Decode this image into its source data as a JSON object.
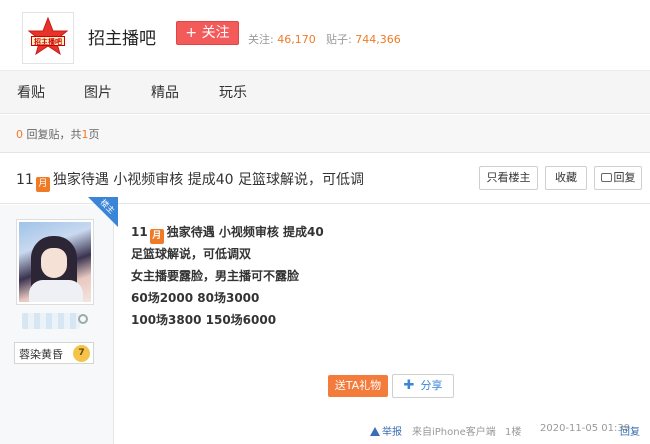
{
  "forum": {
    "logo_text": "招主播吧",
    "name": "招主播吧",
    "follow_label": "+ 关注",
    "follow_count_label": "关注:",
    "follow_count": "46,170",
    "post_count_label": "贴子:",
    "post_count": "744,366"
  },
  "nav": {
    "items": [
      "看贴",
      "图片",
      "精品",
      "玩乐"
    ]
  },
  "pageinfo": {
    "reply_count": "0",
    "reply_label": "回复贴，共",
    "page_count": "1",
    "page_label": "页"
  },
  "thread": {
    "month_num": "11",
    "month_icon": "月",
    "title": "独家待遇 小视频审核 提成40 足篮球解说，可低调",
    "only_author_label": "只看楼主",
    "favorite_label": "收藏",
    "reply_label": "回复"
  },
  "post": {
    "owner_badge": "楼主",
    "level_name": "蓉染黄昏",
    "level_num": "7",
    "content_first_line": "独家待遇 小视频审核 提成40",
    "content_lines": [
      "足篮球解说，可低调双",
      "女主播要露脸，男主播可不露脸",
      "60场2000 80场3000",
      "100场3800 150场6000"
    ],
    "gift_label": "送TA礼物",
    "share_label": "分享",
    "report_label": "举报",
    "source": "来自iPhone客户端",
    "floor": "1楼",
    "time": "2020-11-05 01:39",
    "reply_label": "回复"
  },
  "colors": {
    "accent_orange": "#f07b27",
    "follow_red": "#f35b5b",
    "link_blue": "#3b6fb5"
  }
}
